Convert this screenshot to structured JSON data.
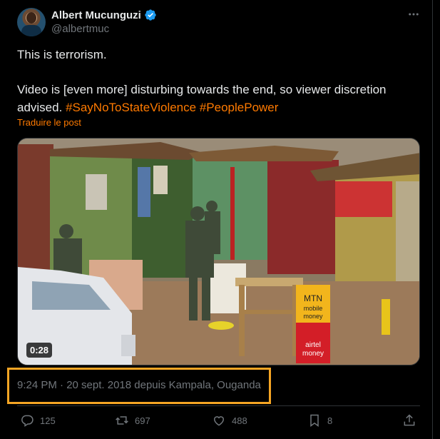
{
  "post": {
    "author_name": "Albert Mucunguzi",
    "handle": "@albertmuc",
    "line1": "This is terrorism.",
    "line2": "Video is [even more] disturbing towards the end, so viewer discretion advised.",
    "hashtag1": "#SayNoToStateViolence",
    "hashtag2": "#PeoplePower",
    "translate_label": "Traduire le post",
    "video_duration": "0:28",
    "timestamp": "9:24 PM · 20 sept. 2018 depuis Kampala, Ouganda"
  },
  "video_scene": {
    "sign_mtn": "MTN",
    "sign_mobile": "mobile",
    "sign_money": "money",
    "sign_airtel": "airtel",
    "sign_airtel_money": "money"
  },
  "actions": {
    "replies": "125",
    "reposts": "697",
    "likes": "488",
    "bookmarks": "8"
  },
  "icons": [
    "verified-badge-icon",
    "more-icon",
    "reply-icon",
    "repost-icon",
    "like-icon",
    "bookmark-icon",
    "share-icon"
  ],
  "colors": {
    "background": "#000000",
    "text": "#e7e9ea",
    "muted": "#71767b",
    "hashtag": "#ff7a00",
    "verified": "#1d9bf0",
    "highlight_box": "#f5a524"
  }
}
